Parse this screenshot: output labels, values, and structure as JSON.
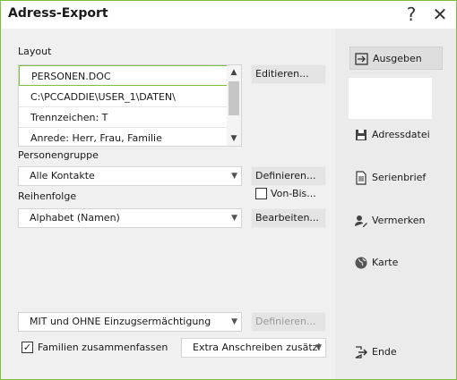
{
  "window": {
    "title": "Adress-Export"
  },
  "titlebar": {
    "help_glyph": "?",
    "close_glyph": "✕"
  },
  "layout": {
    "label": "Layout",
    "items": [
      "PERSONEN.DOC",
      "C:\\PCCADDIE\\USER_1\\DATEN\\",
      "Trennzeichen: T",
      "Anrede: Herr, Frau, Familie"
    ],
    "edit_button": "Editieren..."
  },
  "personengruppe": {
    "label": "Personengruppe",
    "value": "Alle Kontakte",
    "define_button": "Definieren...",
    "von_bis_label": "Von-Bis..."
  },
  "reihenfolge": {
    "label": "Reihenfolge",
    "value": "Alphabet (Namen)",
    "edit_button": "Bearbeiten..."
  },
  "einzug": {
    "value": "MIT und OHNE Einzugsermächtigung",
    "define_button": "Definieren..."
  },
  "familien": {
    "checked": true,
    "label": "Familien zusammenfassen",
    "extra_value": "Extra Anschreiben zusätzl"
  },
  "side": {
    "ausgeben": "Ausgeben",
    "adressdatei": "Adressdatei",
    "serienbrief": "Serienbrief",
    "vermerken": "Vermerken",
    "karte": "Karte",
    "ende": "Ende"
  }
}
